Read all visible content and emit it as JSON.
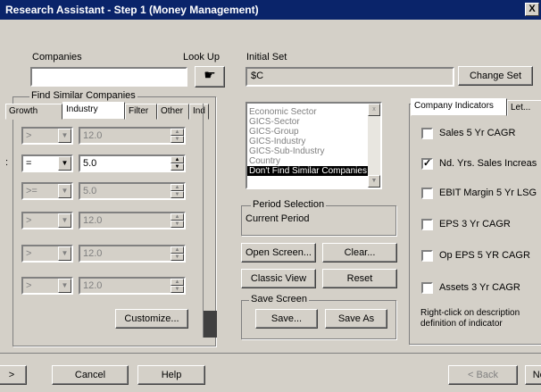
{
  "window": {
    "title": "Research Assistant - Step 1   (Money Management)",
    "close_label": "X"
  },
  "companies": {
    "label": "Companies",
    "value": "",
    "lookup_label": "Look Up"
  },
  "initial_set": {
    "label": "Initial Set",
    "value": "$C",
    "change_set_label": "Change Set"
  },
  "find_similar": {
    "group_label": "Find Similar Companies",
    "tabs": [
      "Growth",
      "Industry",
      "Filter",
      "Other",
      "Ind"
    ],
    "rows": [
      {
        "operator": ">",
        "value": "12.0",
        "enabled": false
      },
      {
        "operator": "=",
        "value": "5.0",
        "enabled": true
      },
      {
        "operator": ">=",
        "value": "5.0",
        "enabled": false
      },
      {
        "operator": ">",
        "value": "12.0",
        "enabled": false
      },
      {
        "operator": ">",
        "value": "12.0",
        "enabled": false
      },
      {
        "operator": ">",
        "value": "12.0",
        "enabled": false
      }
    ],
    "customize_label": "Customize..."
  },
  "similar_list": {
    "items": [
      "Economic Sector",
      "GICS-Sector",
      "GICS-Group",
      "GICS-Industry",
      "GICS-Sub-Industry",
      "Country",
      "Don't Find Similar Companies"
    ],
    "selected_index": 6
  },
  "period": {
    "group_label": "Period Selection",
    "value": "Current Period"
  },
  "actions": {
    "open_screen": "Open Screen...",
    "clear": "Clear...",
    "classic_view": "Classic View",
    "reset": "Reset"
  },
  "save_screen": {
    "group_label": "Save Screen",
    "save": "Save...",
    "save_as": "Save As"
  },
  "indicators": {
    "tabs": [
      "Company Indicators",
      "Let..."
    ],
    "items": [
      {
        "label": "Sales 5 Yr CAGR",
        "checked": false
      },
      {
        "label": "Nd. Yrs. Sales Increas",
        "checked": true
      },
      {
        "label": "EBIT Margin 5 Yr LSG",
        "checked": false
      },
      {
        "label": "EPS 3 Yr CAGR",
        "checked": false
      },
      {
        "label": "Op EPS 5 YR CAGR",
        "checked": false
      },
      {
        "label": "Assets 3 Yr CAGR",
        "checked": false
      }
    ],
    "note_line1": "Right-click on description",
    "note_line2": "definition of indicator"
  },
  "footer": {
    "back_arrow": ">",
    "cancel": "Cancel",
    "help": "Help",
    "back": "< Back",
    "next": "Next"
  }
}
